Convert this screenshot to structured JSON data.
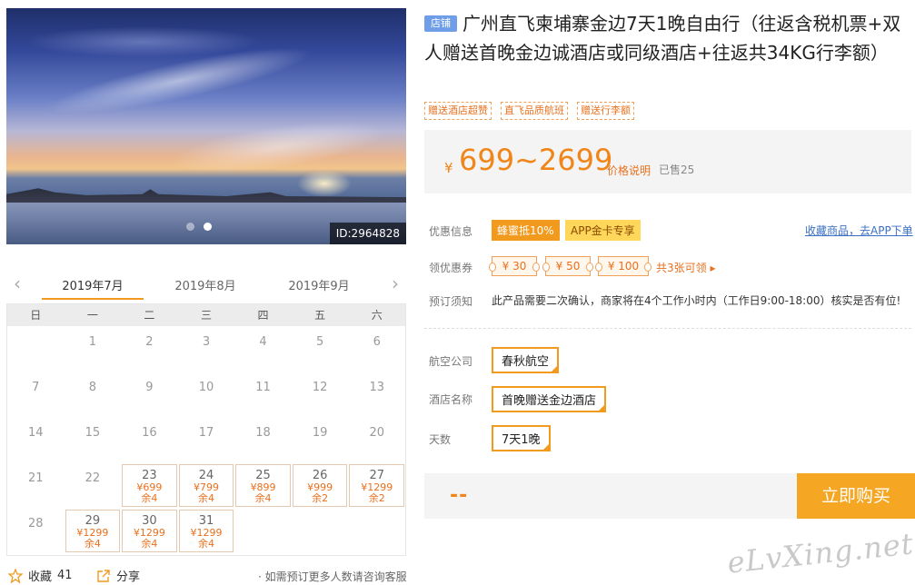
{
  "gallery": {
    "image_id": "ID:2964828",
    "slide_count": 2,
    "active_slide": 2
  },
  "calendar": {
    "prev_arrow": "‹",
    "next_arrow": "›",
    "months": [
      "2019年7月",
      "2019年8月",
      "2019年9月"
    ],
    "active_month": 0,
    "weekdays": [
      "日",
      "一",
      "二",
      "三",
      "四",
      "五",
      "六"
    ],
    "days": [
      {
        "day": ""
      },
      {
        "day": "1"
      },
      {
        "day": "2"
      },
      {
        "day": "3"
      },
      {
        "day": "4"
      },
      {
        "day": "5"
      },
      {
        "day": "6"
      },
      {
        "day": "7"
      },
      {
        "day": "8"
      },
      {
        "day": "9"
      },
      {
        "day": "10"
      },
      {
        "day": "11"
      },
      {
        "day": "12"
      },
      {
        "day": "13"
      },
      {
        "day": "14"
      },
      {
        "day": "15"
      },
      {
        "day": "16"
      },
      {
        "day": "17"
      },
      {
        "day": "18"
      },
      {
        "day": "19"
      },
      {
        "day": "20"
      },
      {
        "day": "21"
      },
      {
        "day": "22"
      },
      {
        "day": "23",
        "price": "¥699",
        "left": "余4"
      },
      {
        "day": "24",
        "price": "¥799",
        "left": "余4"
      },
      {
        "day": "25",
        "price": "¥899",
        "left": "余4"
      },
      {
        "day": "26",
        "price": "¥999",
        "left": "余2"
      },
      {
        "day": "27",
        "price": "¥1299",
        "left": "余2"
      },
      {
        "day": "28"
      },
      {
        "day": "29",
        "price": "¥1299",
        "left": "余4"
      },
      {
        "day": "30",
        "price": "¥1299",
        "left": "余4"
      },
      {
        "day": "31",
        "price": "¥1299",
        "left": "余4"
      }
    ]
  },
  "actions": {
    "favorite_label": "收藏",
    "favorite_count": "41",
    "share_label": "分享",
    "consult_text": "· 如需预订更多人数请咨询客服"
  },
  "product": {
    "shop_badge": "店铺",
    "title": "广州直飞柬埔寨金边7天1晚自由行（往返含税机票+双人赠送首晚金边诚酒店或同级酒店+往返共34KG行李额）",
    "tags": [
      "赠送酒店超赞",
      "直飞品质航班",
      "赠送行李额"
    ]
  },
  "price": {
    "currency": "¥",
    "range": "699~2699",
    "explain_link": "价格说明",
    "sold": "已售25"
  },
  "promo": {
    "label": "优惠信息",
    "tag1": "蜂蜜抵10%",
    "tag2": "APP金卡专享",
    "fav_app_link": "收藏商品，去APP下单"
  },
  "coupons": {
    "label": "领优惠券",
    "items": [
      "¥ 30",
      "¥ 50",
      "¥ 100"
    ],
    "more": "共3张可领 ▸"
  },
  "notice": {
    "label": "预订须知",
    "text": "此产品需要二次确认，商家将在4个工作小时内（工作日9:00-18:00）核实是否有位!"
  },
  "options": {
    "airline_label": "航空公司",
    "airline_value": "春秋航空",
    "hotel_label": "酒店名称",
    "hotel_value": "首晚赠送金边酒店",
    "days_label": "天数",
    "days_value": "7天1晚"
  },
  "purchase": {
    "total_placeholder": "--",
    "buy_label": "立即购买"
  },
  "watermark": "eLvXing.net",
  "colors": {
    "accent": "#f29a1e",
    "price": "#f08519",
    "link": "#3a6fc4",
    "shop_badge": "#6f9ee9"
  }
}
